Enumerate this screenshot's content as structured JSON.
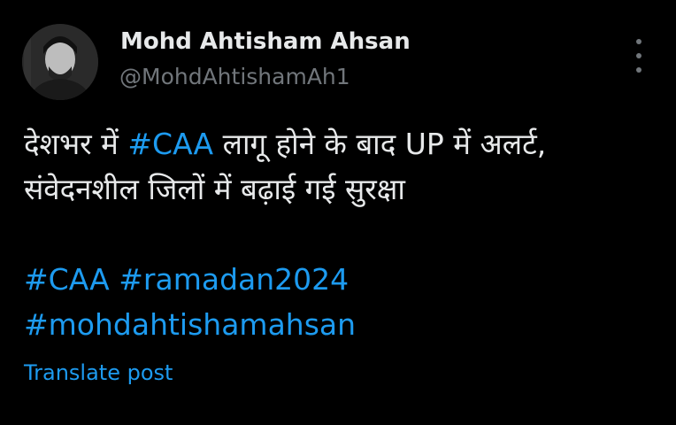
{
  "post": {
    "author": {
      "display_name": "Mohd Ahtisham Ahsan",
      "handle": "@MohdAhtishamAh1"
    },
    "more_icon": "more-vertical-icon",
    "text": {
      "line1_prefix": "देशभर में ",
      "line1_hashtag": "#CAA",
      "line1_suffix": " लागू होने के बाद UP में अलर्ट,",
      "line2": "संवेदनशील जिलों में बढ़ाई गई सुरक्षा",
      "hashtags_line1": [
        "#CAA",
        "#ramadan2024"
      ],
      "hashtags_line2": [
        "#mohdahtishamahsan"
      ]
    },
    "translate_label": "Translate post"
  },
  "colors": {
    "background": "#000000",
    "text": "#e7e9ea",
    "secondary": "#71767b",
    "link": "#1d9bf0"
  }
}
